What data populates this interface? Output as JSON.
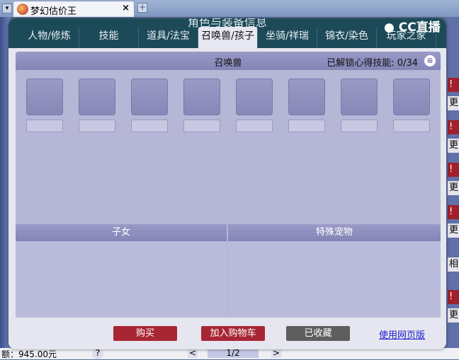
{
  "browser": {
    "tab_title": "梦幻估价王",
    "close": "×",
    "new_tab": "+",
    "menu": "▾"
  },
  "dialog": {
    "title": "角色与装备信息",
    "logo": "CC直播",
    "nav": [
      "人物/修炼",
      "技能",
      "道具/法宝",
      "召唤兽/孩子",
      "坐骑/祥瑞",
      "锦衣/染色",
      "玩家之家"
    ],
    "active_tab": "召唤兽/孩子",
    "pets": {
      "title": "召唤兽",
      "unlocked_label": "已解锁心得技能:",
      "unlocked_value": "0/34",
      "menu_icon": "list-icon"
    },
    "children_title": "子女",
    "special_title": "特殊宠物",
    "buttons": {
      "buy": "购买",
      "add_cart": "加入购物车",
      "favorited": "已收藏",
      "web_version": "使用网页版"
    },
    "colors": {
      "buy": "#a82634",
      "favorited": "#5e5e5e",
      "header": "#1d4a58"
    }
  },
  "right_strip": [
    "!",
    "更",
    "!",
    "更",
    "!",
    "更",
    "!",
    "更",
    "相",
    "!",
    "更"
  ],
  "bottom": {
    "price": "额：945.00元",
    "help": "?",
    "prev": "<",
    "page": "1/2",
    "next": ">"
  }
}
